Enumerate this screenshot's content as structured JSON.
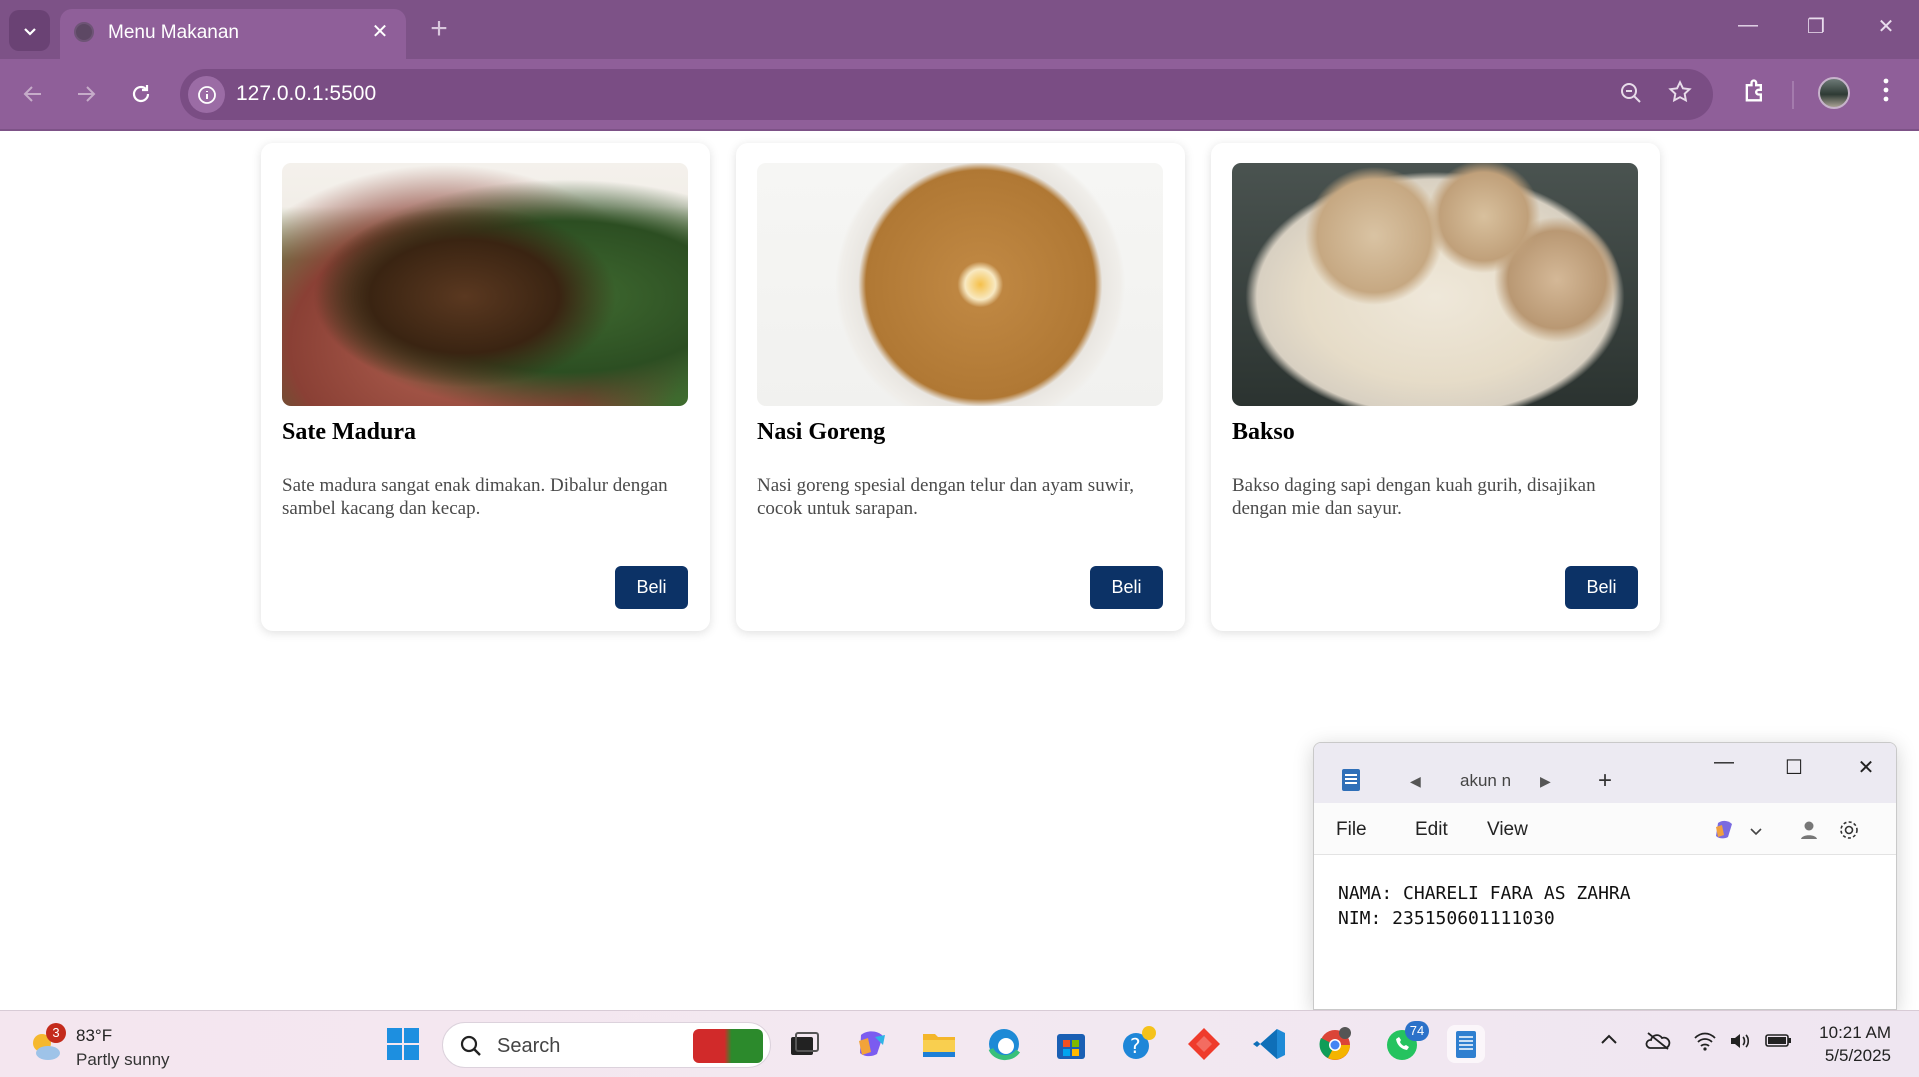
{
  "browser": {
    "tab_title": "Menu Makanan",
    "url": "127.0.0.1:5500"
  },
  "menu": {
    "items": [
      {
        "name": "Sate Madura",
        "description": "Sate madura sangat enak dimakan. Dibalur dengan sambel kacang dan kecap.",
        "button": "Beli"
      },
      {
        "name": "Nasi Goreng",
        "description": "Nasi goreng spesial dengan telur dan ayam suwir, cocok untuk sarapan.",
        "button": "Beli"
      },
      {
        "name": "Bakso",
        "description": "Bakso daging sapi dengan kuah gurih, disajikan dengan mie dan sayur.",
        "button": "Beli"
      }
    ]
  },
  "notepad": {
    "tab_label": "akun n",
    "menu": [
      "File",
      "Edit",
      "View"
    ],
    "lines": [
      "NAMA: CHARELI FARA AS ZAHRA",
      "NIM: 235150601111030"
    ]
  },
  "taskbar": {
    "weather_badge": "3",
    "temperature": "83°F",
    "condition": "Partly sunny",
    "search_label": "Search",
    "whatsapp_badge": "74",
    "time": "10:21 AM",
    "date": "5/5/2025"
  },
  "colors": {
    "chrome": "#8f5f99",
    "buy_button": "#0c3266"
  }
}
